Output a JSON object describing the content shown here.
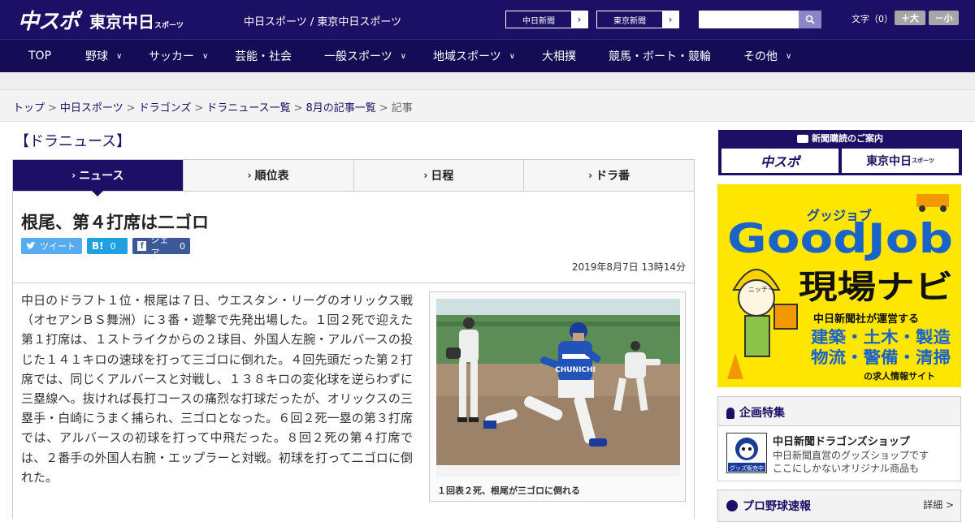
{
  "header": {
    "logo_chuspo": "中スポ",
    "logo_tokyo": "東京中日",
    "logo_tokyo_sub": "スポーツ",
    "tagline": "中日スポーツ / 東京中日スポーツ",
    "site_links": [
      "中日新聞",
      "東京新聞"
    ],
    "search_placeholder": "",
    "font_label": "文字（0）",
    "font_larger": "＋大",
    "font_smaller": "－小"
  },
  "nav": {
    "items": [
      {
        "label": "TOP"
      },
      {
        "label": "野球"
      },
      {
        "label": "サッカー"
      },
      {
        "label": "芸能・社会"
      },
      {
        "label": "一般スポーツ"
      },
      {
        "label": "地域スポーツ"
      },
      {
        "label": "大相撲"
      },
      {
        "label": "競馬・ボート・競輪"
      },
      {
        "label": "その他"
      }
    ]
  },
  "breadcrumb": [
    "トップ",
    "中日スポーツ",
    "ドラゴンズ",
    "ドラニュース一覧",
    "8月の記事一覧",
    "記事"
  ],
  "section_title": "【ドラニュース】",
  "tabs": [
    {
      "label": "ニュース",
      "active": true
    },
    {
      "label": "順位表",
      "active": false
    },
    {
      "label": "日程",
      "active": false
    },
    {
      "label": "ドラ番",
      "active": false
    }
  ],
  "article": {
    "headline": "根尾、第４打席は二ゴロ",
    "share": {
      "tweet_label": "ツイート",
      "hatena_label": "B!",
      "hatena_count": "0",
      "fb_label": "シェア",
      "fb_count": "0"
    },
    "date": "2019年8月7日 13時14分",
    "body": "中日のドラフト１位・根尾は７日、ウエスタン・リーグのオリックス戦（オセアンＢＳ舞洲）に３番・遊撃で先発出場した。１回２死で迎えた第１打席は、１ストライクからの２球目、外国人左腕・アルバースの投じた１４１キロの速球を打って三ゴロに倒れた。４回先頭だった第２打席では、同じくアルバースと対戦し、１３８キロの変化球を逆らわずに三塁線へ。抜ければ長打コースの痛烈な打球だったが、オリックスの三塁手・白崎にうまく捕られ、三ゴロとなった。６回２死一塁の第３打席では、アルバースの初球を打って中飛だった。８回２死の第４打席では、２番手の外国人右腕・エップラーと対戦。初球を打って二ゴロに倒れた。",
    "photo_caption": "１回表２死、根尾が三ゴロに倒れる",
    "photo_uniform_text": "CHUNICHI"
  },
  "sidebar": {
    "promo_header": "新聞購読のご案内",
    "promo_chuspo": "中スポ",
    "promo_tokyo": "東京中日",
    "promo_tokyo_sub": "スポーツ",
    "ad": {
      "kana": "グッジョブ",
      "title": "GoodJob",
      "sub": "現場ナビ",
      "by": "中日新聞社が運営する",
      "line1": "建築・土木・製造",
      "line2": "物流・警備・清掃",
      "line3": "の求人情報サイト",
      "sign": "ニッチー"
    },
    "kikaku": {
      "title": "企画特集",
      "shop_title": "中日新聞ドラゴンズショップ",
      "shop_desc1": "中日新聞直営のグッズショップです",
      "shop_desc2": "ここにしかないオリジナル商品も",
      "shop_badge": "グッズ販売中"
    },
    "sokuhou": {
      "title": "プロ野球速報",
      "more": "詳細 >"
    }
  }
}
